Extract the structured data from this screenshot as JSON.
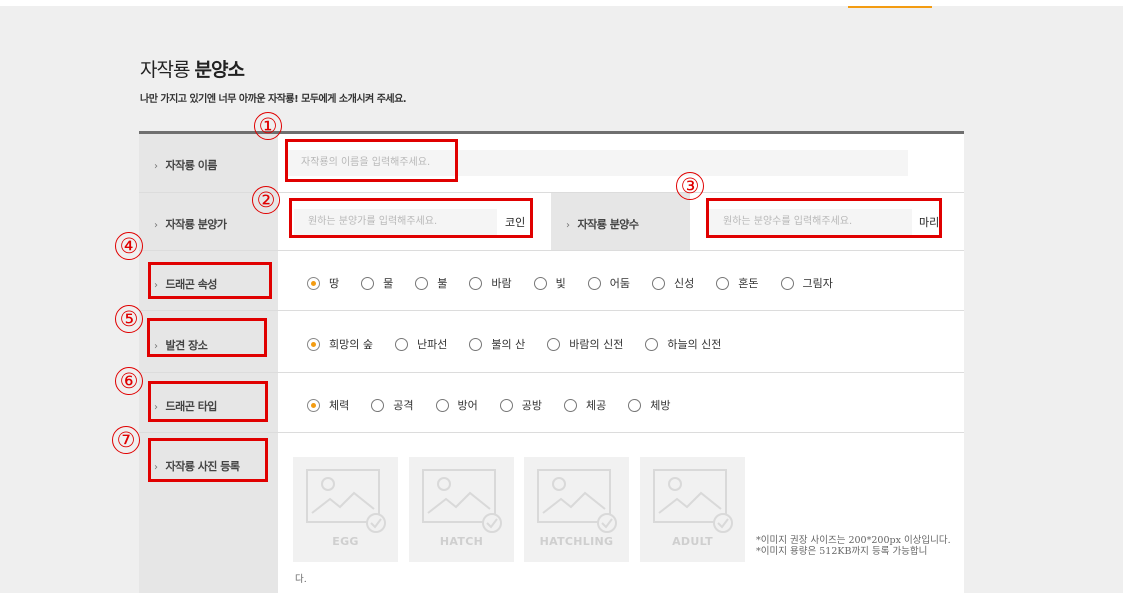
{
  "header": {
    "title_normal": "자작룡",
    "title_bold": "분양소",
    "subtitle": "나만 가지고 있기엔 너무 아까운 자작룡! 모두에게 소개시켜 주세요."
  },
  "form": {
    "name": {
      "label": "자작룡 이름",
      "placeholder": "자작룡의 이름을 입력해주세요."
    },
    "price": {
      "label": "자작룡 분양가",
      "placeholder": "원하는 분양가를 입력해주세요.",
      "unit": "코인"
    },
    "count": {
      "label": "자작룡 분양수",
      "placeholder": "원하는 분양수를 입력해주세요.",
      "unit": "마리"
    },
    "attribute": {
      "label": "드래곤 속성",
      "options": [
        "땅",
        "물",
        "불",
        "바람",
        "빛",
        "어둠",
        "신성",
        "혼돈",
        "그림자"
      ],
      "selected": "땅"
    },
    "location": {
      "label": "발견 장소",
      "options": [
        "희망의 숲",
        "난파선",
        "불의 산",
        "바람의 신전",
        "하늘의 신전"
      ],
      "selected": "희망의 숲"
    },
    "type": {
      "label": "드래곤 타입",
      "options": [
        "체력",
        "공격",
        "방어",
        "공방",
        "체공",
        "체방"
      ],
      "selected": "체력"
    },
    "photo": {
      "label": "자작룡 사진 등록",
      "slots": [
        "EGG",
        "HATCH",
        "HATCHLING",
        "ADULT"
      ],
      "note_line1": "*이미지 권장 사이즈는 200*200px 이상입니다.",
      "note_line2": "*이미지 용량은 512KB까지 등록 가능합니",
      "note_tail": "다."
    }
  },
  "annotations": [
    "①",
    "②",
    "③",
    "④",
    "⑤",
    "⑥",
    "⑦"
  ],
  "colors": {
    "accent": "#f39c12",
    "highlight": "#e00000",
    "header_border": "#6f6f6f"
  }
}
